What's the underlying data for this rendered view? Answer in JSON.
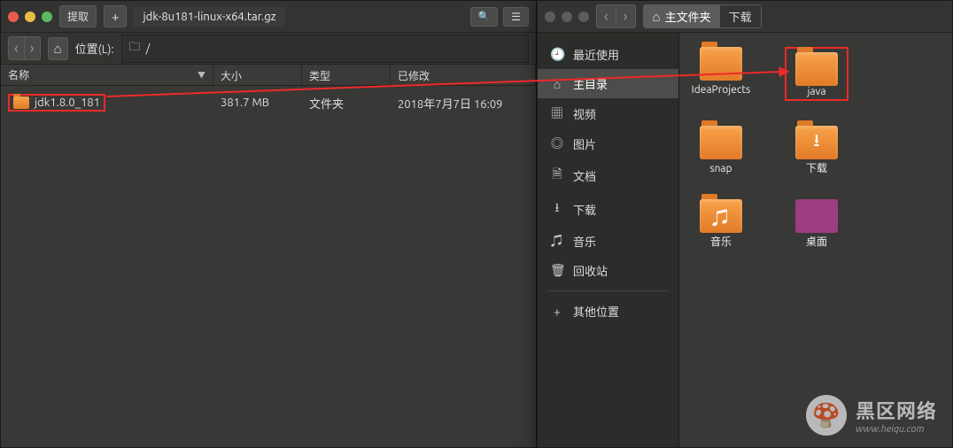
{
  "left_window": {
    "extract_label": "提取",
    "tab_title": "jdk-8u181-linux-x64.tar.gz",
    "location_label": "位置(L):",
    "location_path": "/",
    "columns": {
      "name": "名称",
      "size": "大小",
      "type": "类型",
      "modified": "已修改"
    },
    "row": {
      "name": "jdk1.8.0_181",
      "size": "381.7 MB",
      "type": "文件夹",
      "modified": "2018年7月7日 16:09"
    }
  },
  "right_window": {
    "breadcrumb_home": "主文件夹",
    "breadcrumb_downloads": "下载",
    "sidebar": [
      {
        "icon": "🕘",
        "label": "最近使用"
      },
      {
        "icon": "⌂",
        "label": "主目录",
        "selected": true
      },
      {
        "icon": "▦",
        "label": "视频"
      },
      {
        "icon": "◎",
        "label": "图片"
      },
      {
        "icon": "🗎",
        "label": "文档"
      },
      {
        "icon": "⭳",
        "label": "下载"
      },
      {
        "icon": "♫",
        "label": "音乐"
      },
      {
        "icon": "🗑",
        "label": "回收站"
      },
      {
        "icon": "+",
        "label": "其他位置"
      }
    ],
    "folders": [
      {
        "label": "IdeaProjects",
        "overlay": ""
      },
      {
        "label": "java",
        "overlay": "",
        "highlight": true
      },
      {
        "label": "snap",
        "overlay": ""
      },
      {
        "label": "下载",
        "overlay": "⭳"
      },
      {
        "label": "音乐",
        "overlay": "♫"
      },
      {
        "label": "桌面",
        "overlay": "",
        "desktop": true
      }
    ]
  },
  "watermark": {
    "title": "黑区网络",
    "url": "www.heiqu.com",
    "icon": "🍄"
  }
}
